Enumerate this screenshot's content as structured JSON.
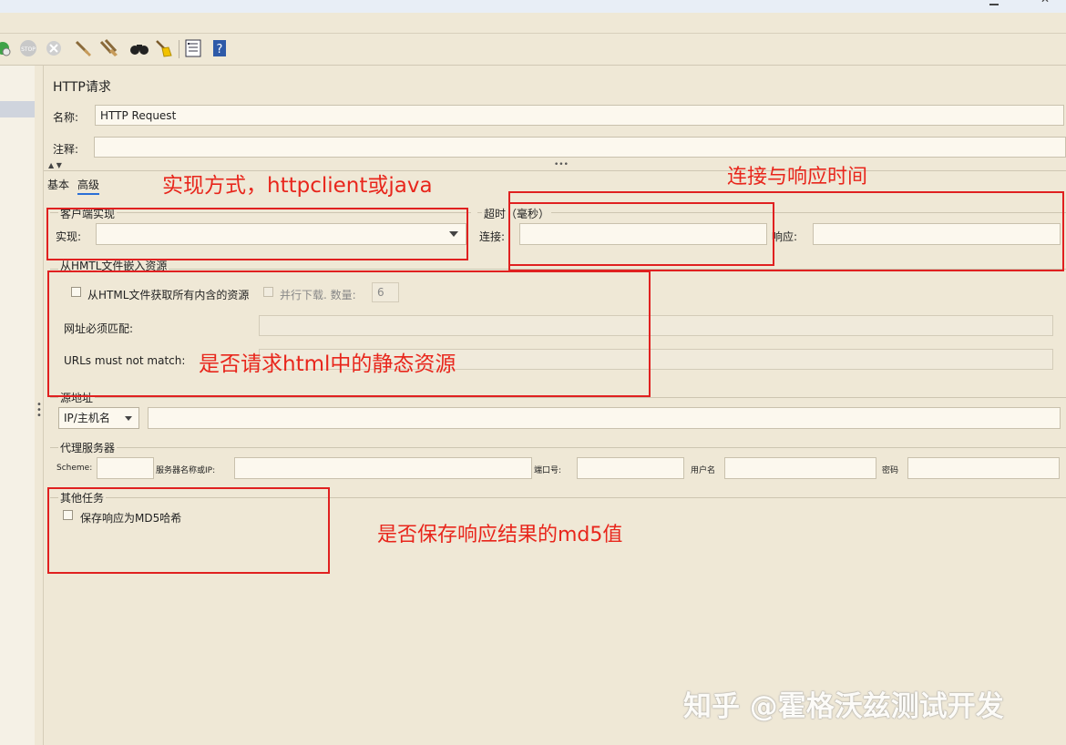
{
  "window": {
    "title_text": "",
    "close_glyph": "✕"
  },
  "panel": {
    "title": "HTTP请求"
  },
  "form": {
    "name_label": "名称:",
    "name_value": "HTTP Request",
    "comment_label": "注释:",
    "comment_value": ""
  },
  "tabs": [
    {
      "label": "基本"
    },
    {
      "label": "高级"
    }
  ],
  "client_impl": {
    "section_label": "客户端实现",
    "impl_label": "实现:",
    "impl_value": ""
  },
  "timeout": {
    "section_label": "超时（毫秒）",
    "connect_label": "连接:",
    "connect_value": "",
    "response_label": "响应:",
    "response_value": ""
  },
  "embedded": {
    "section_label": "从HMTL文件嵌入资源",
    "retrieve_label": "从HTML文件获取所有内含的资源",
    "parallel_label": "并行下载. 数量:",
    "parallel_value": "6",
    "must_match_label": "网址必须匹配:",
    "must_not_match_label": "URLs must not match:"
  },
  "source": {
    "section_label": "源地址",
    "type_value": "IP/主机名",
    "address_value": ""
  },
  "proxy": {
    "section_label": "代理服务器",
    "scheme_label": "Scheme:",
    "server_label": "服务器名称或IP:",
    "port_label": "端口号:",
    "user_label": "用户名",
    "password_label": "密码"
  },
  "other": {
    "section_label": "其他任务",
    "md5_label": "保存响应为MD5哈希"
  },
  "annotations": {
    "impl": "实现方式，httpclient或java",
    "timeout": "连接与响应时间",
    "static": "是否请求html中的静态资源",
    "md5": "是否保存响应结果的md5值"
  },
  "watermark": "知乎 @霍格沃兹测试开发",
  "colors": {
    "annotation": "#e8261c",
    "background": "#efe8d6",
    "field": "#fcf8ee"
  }
}
